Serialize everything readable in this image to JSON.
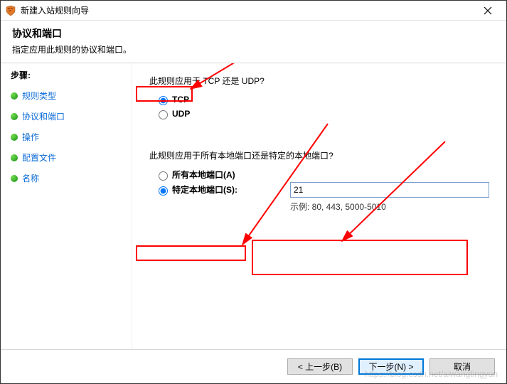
{
  "window": {
    "title": "新建入站规则向导"
  },
  "header": {
    "title": "协议和端口",
    "subtitle": "指定应用此规则的协议和端口。"
  },
  "sidebar": {
    "steps_label": "步骤:",
    "items": [
      {
        "label": "规则类型"
      },
      {
        "label": "协议和端口"
      },
      {
        "label": "操作"
      },
      {
        "label": "配置文件"
      },
      {
        "label": "名称"
      }
    ]
  },
  "content": {
    "protocol_question": "此规则应用于 TCP 还是 UDP?",
    "protocol_options": {
      "tcp": "TCP",
      "udp": "UDP"
    },
    "port_question": "此规则应用于所有本地端口还是特定的本地端口?",
    "port_options": {
      "all": "所有本地端口(A)",
      "specific": "特定本地端口(S):"
    },
    "port_value": "21",
    "port_example": "示例: 80, 443, 5000-5010"
  },
  "footer": {
    "back": "< 上一步(B)",
    "next": "下一步(N) >",
    "cancel": "取消"
  },
  "watermark": "https://blog.csdn.net/aiwangtingyun"
}
